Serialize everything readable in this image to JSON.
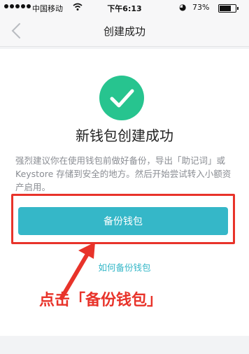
{
  "status_bar": {
    "carrier": "中国移动",
    "time": "下午6:13",
    "battery": "73%",
    "battery_level": 0.73
  },
  "nav": {
    "title": "创建成功"
  },
  "main": {
    "headline": "新钱包创建成功",
    "description": "强烈建议你在使用钱包前做好备份，导出「助记词」或 Keystore 存储到安全的地方。然后开始尝试转入小额资产启用。",
    "backup_button_label": "备份钱包",
    "how_to_backup_link": "如何备份钱包"
  },
  "annotation": {
    "text": "点击「备份钱包」"
  },
  "colors": {
    "accent": "#35b7c8",
    "success": "#27c48f",
    "annotation": "#e8332a"
  }
}
